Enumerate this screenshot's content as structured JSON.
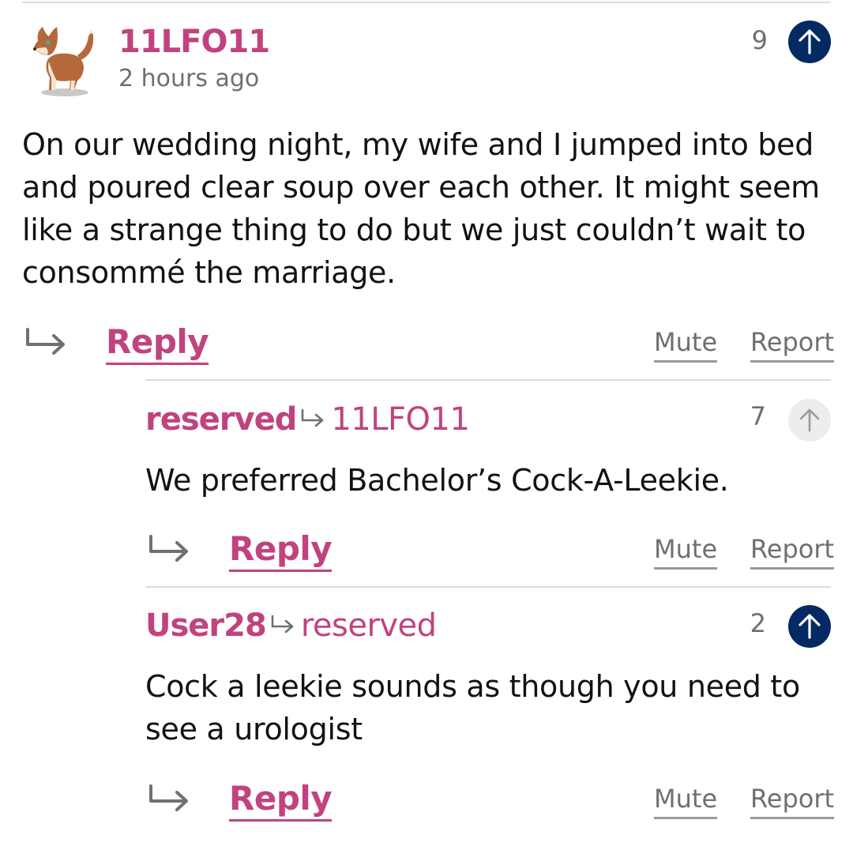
{
  "comments": [
    {
      "author": "11LFO11",
      "timestamp": "2 hours ago",
      "recommend_count": "9",
      "recommended": true,
      "body": "On our wedding night, my wife and I jumped into bed and poured clear soup over each other. It might seem like a strange thing to do but we just couldn’t wait to consommé the marriage.",
      "reply_label": "Reply",
      "mute_label": "Mute",
      "report_label": "Report",
      "avatar": "fox-dog-avatar"
    },
    {
      "author": "reserved",
      "in_reply_to": "11LFO11",
      "recommend_count": "7",
      "recommended": false,
      "body": "We preferred Bachelor’s Cock-A-Leekie.",
      "reply_label": "Reply",
      "mute_label": "Mute",
      "report_label": "Report"
    },
    {
      "author": "User28",
      "in_reply_to": "reserved",
      "recommend_count": "2",
      "recommended": true,
      "body": "Cock a leekie sounds as though you need to see a urologist",
      "reply_label": "Reply",
      "mute_label": "Mute",
      "report_label": "Report"
    }
  ],
  "colors": {
    "accent": "#c0437f",
    "vote_active": "#052962",
    "vote_inactive": "#ededed",
    "muted_text": "#6f6f6f",
    "divider": "#dcdcdc"
  },
  "icons": {
    "upvote": "arrow-up-icon",
    "reply": "reply-arrow-icon",
    "in_reply_to": "small-reply-arrow-icon"
  }
}
